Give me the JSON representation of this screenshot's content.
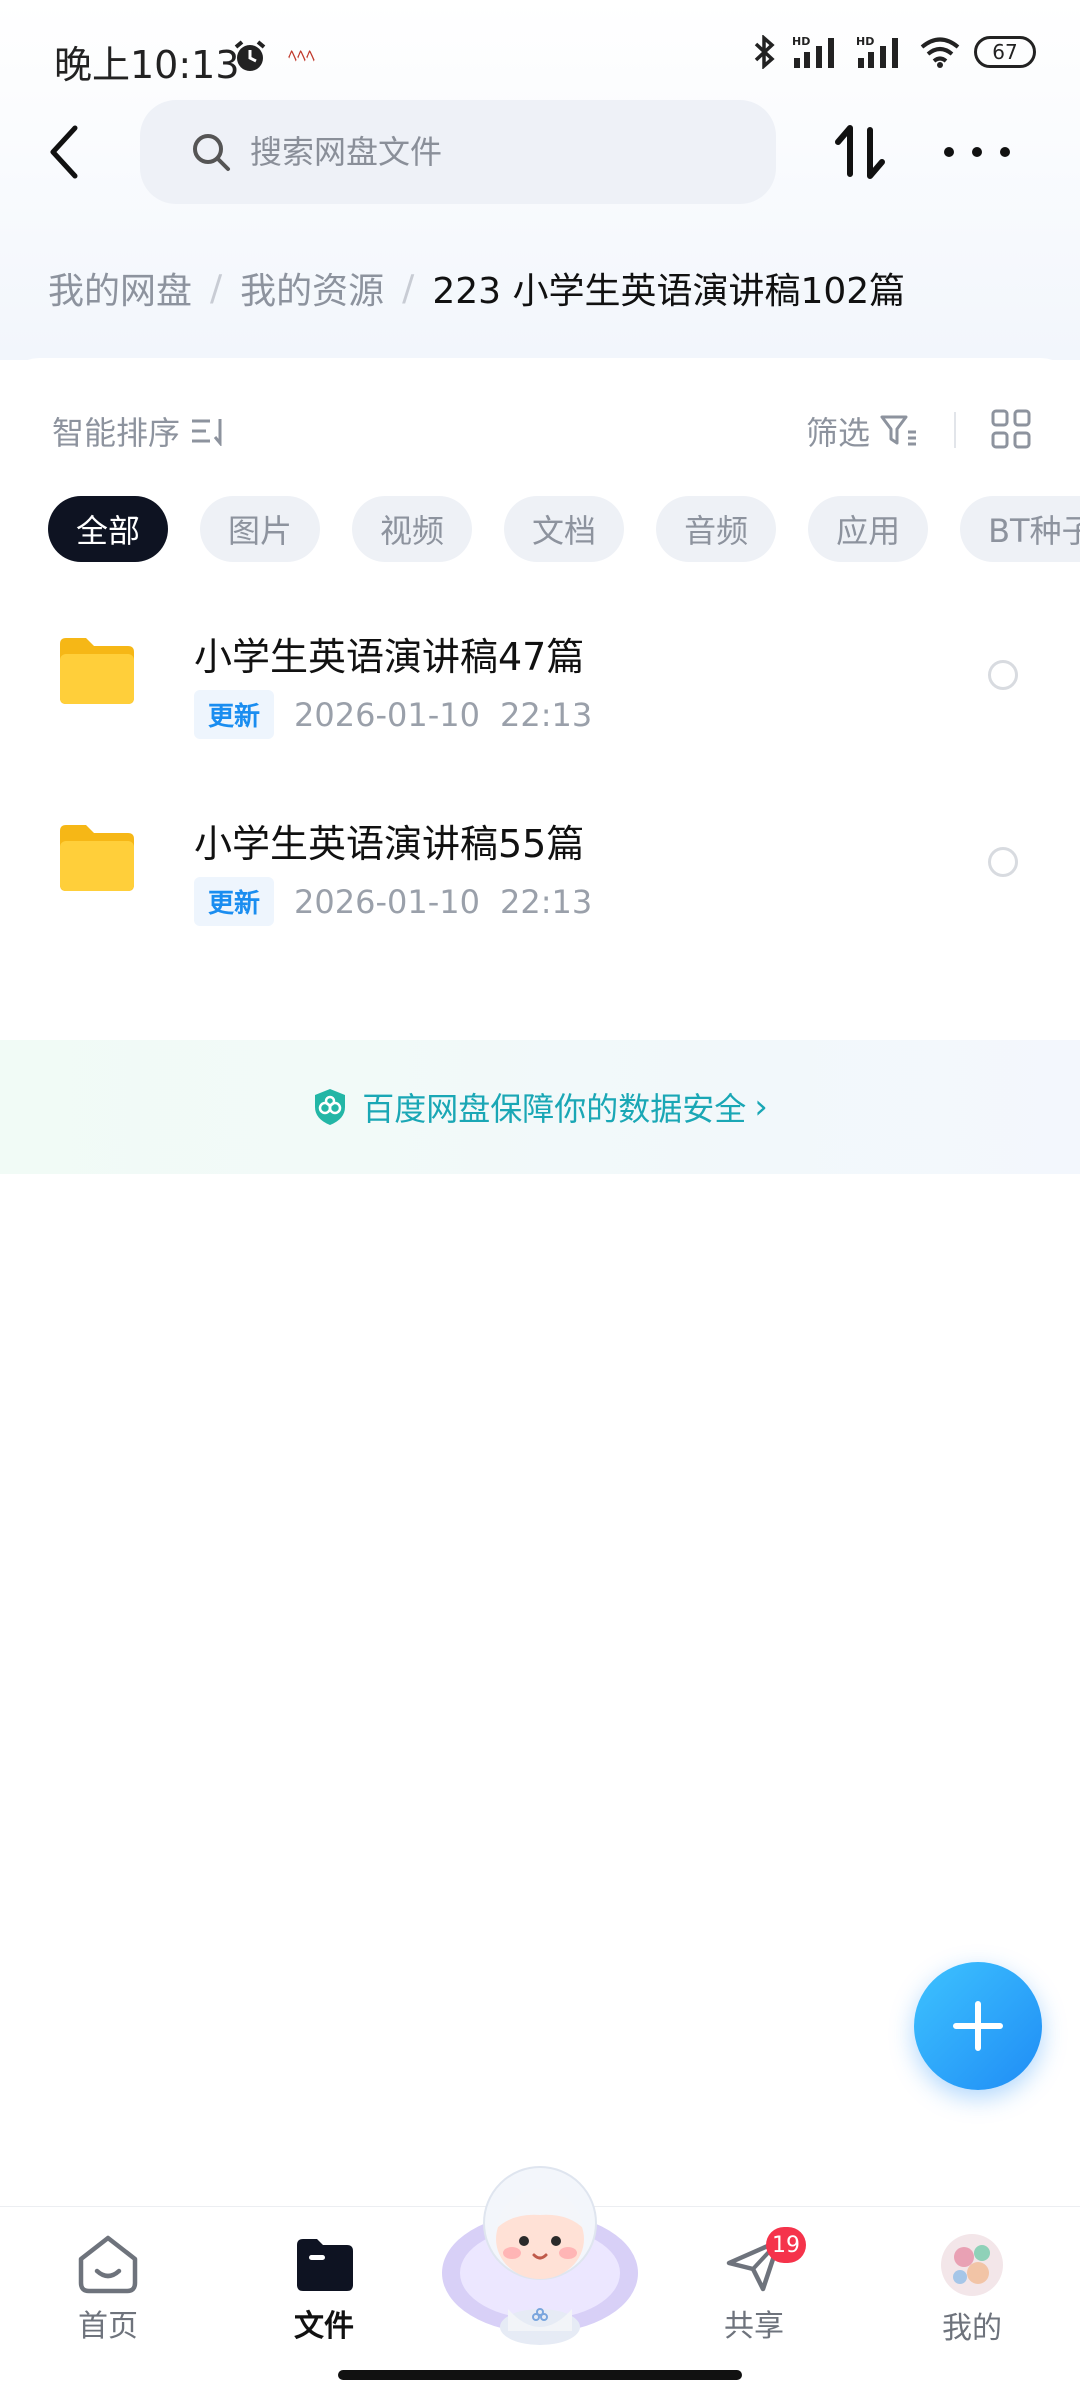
{
  "status_bar": {
    "time": "晚上10:13",
    "notification_text": "ﾍﾍﾍ",
    "battery": "67",
    "signal_label_1": "HD",
    "signal_label_2": "HD"
  },
  "header": {
    "search_placeholder": "搜索网盘文件"
  },
  "breadcrumb": {
    "items": [
      "我的网盘",
      "我的资源"
    ],
    "current": "223  小学生英语演讲稿102篇"
  },
  "toolbar": {
    "sort_label": "智能排序",
    "filter_label": "筛选"
  },
  "chips": [
    "全部",
    "图片",
    "视频",
    "文档",
    "音频",
    "应用",
    "BT种子"
  ],
  "files": [
    {
      "name": "小学生英语演讲稿47篇",
      "badge": "更新",
      "date": "2026-01-10",
      "time": "22:13"
    },
    {
      "name": "小学生英语演讲稿55篇",
      "badge": "更新",
      "date": "2026-01-10",
      "time": "22:13"
    }
  ],
  "security_banner": {
    "text": "百度网盘保障你的数据安全",
    "chevron": "›"
  },
  "bottom_nav": {
    "home": "首页",
    "files": "文件",
    "share": "共享",
    "share_badge": "19",
    "me": "我的"
  },
  "colors": {
    "accent": "#1f8cf5",
    "active_chip": "#0e1322",
    "badge_red": "#f5334b",
    "security_teal": "#1aa7b5",
    "folder_yellow": "#ffc92e"
  }
}
